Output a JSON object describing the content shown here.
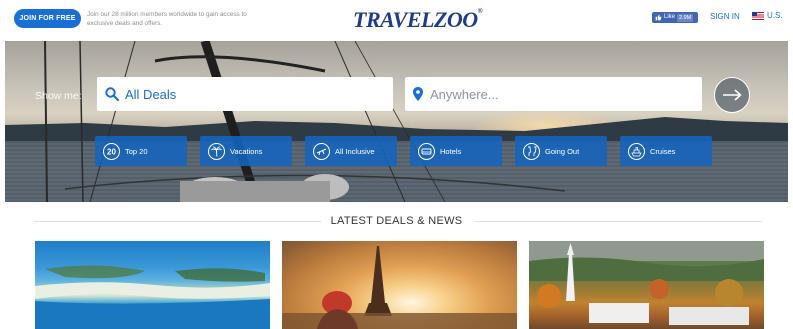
{
  "header": {
    "join_label": "JOIN FOR FREE",
    "join_text": "Join our 28 million members worldwide to gain access to exclusive deals and offers.",
    "logo": "TRAVELZOO",
    "logo_mark": "®",
    "fb_like_label": "Like",
    "fb_like_count": "2.9M",
    "sign_in_label": "SIGN IN",
    "locale_label": "U.S."
  },
  "hero": {
    "show_me_label": "Show me:",
    "search_value": "All Deals",
    "where_placeholder": "Anywhere...",
    "categories": [
      {
        "label": "Top 20",
        "icon": "top-20-icon"
      },
      {
        "label": "Vacations",
        "icon": "palm-tree-icon"
      },
      {
        "label": "All Inclusive",
        "icon": "plane-icon"
      },
      {
        "label": "Hotels",
        "icon": "bed-icon"
      },
      {
        "label": "Going Out",
        "icon": "cheers-icon"
      },
      {
        "label": "Cruises",
        "icon": "ship-icon"
      }
    ]
  },
  "latest": {
    "title": "LATEST DEALS & NEWS"
  },
  "colors": {
    "accent": "#1a6fd6",
    "logo": "#1f3c8a",
    "category_bg": "#1664be"
  }
}
